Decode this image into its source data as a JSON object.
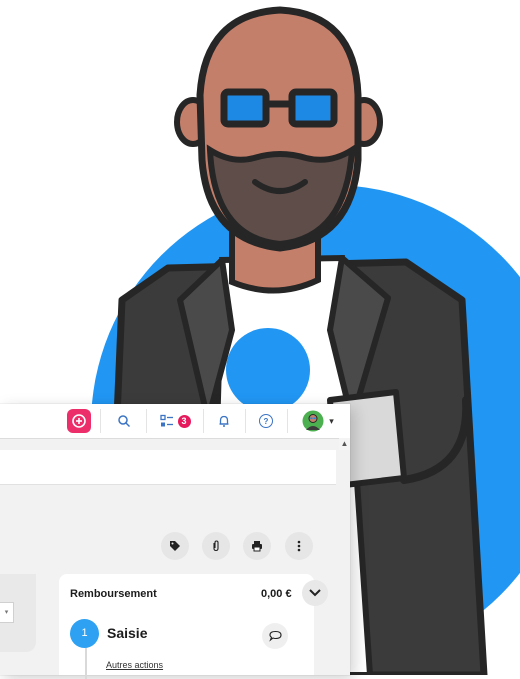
{
  "topbar": {
    "tasks_badge": "3",
    "help_symbol": "?",
    "dropdown_symbol": "▾"
  },
  "scrollbar": {
    "up_symbol": "▲"
  },
  "select": {
    "arrow": "▾"
  },
  "panel": {
    "title": "Remboursement",
    "amount": "0,00 €",
    "step": {
      "number": "1",
      "label": "Saisie"
    },
    "other_actions_link": "Autres actions"
  },
  "colors": {
    "accent_pink": "#ec2f6b",
    "badge_pink": "#e5195b",
    "step_blue": "#2ea1f2",
    "illustration_blue": "#2196f3",
    "skin": "#c47f6b",
    "beard": "#5e4d49",
    "jacket": "#3b3b3b",
    "glasses": "#1e88e5"
  },
  "icons": [
    "plus-circle-icon",
    "search-icon",
    "task-list-icon",
    "bell-icon",
    "help-icon",
    "user-avatar",
    "tag-icon",
    "paperclip-icon",
    "print-icon",
    "more-vert-icon",
    "chevron-down-icon",
    "comment-icon"
  ]
}
